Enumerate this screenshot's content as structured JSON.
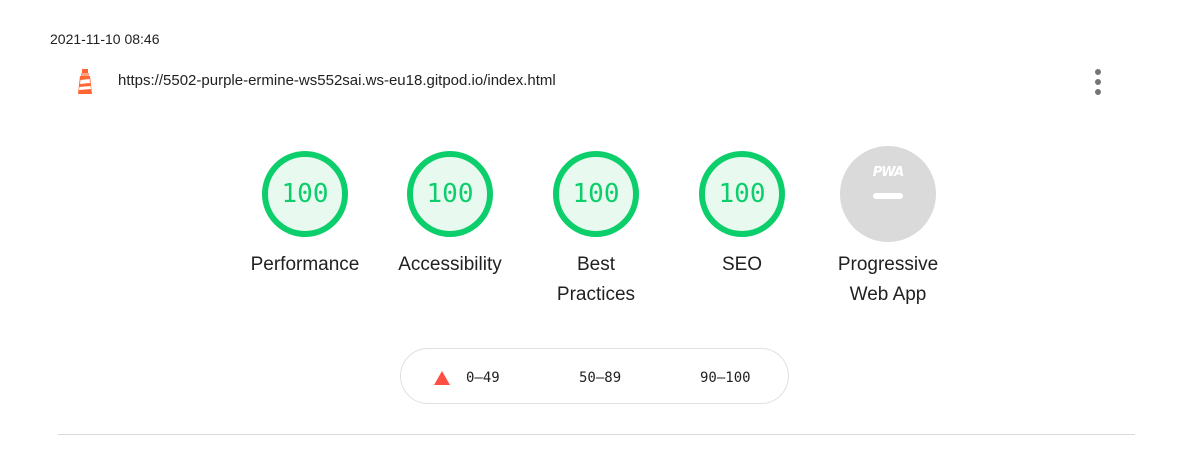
{
  "header": {
    "timestamp": "2021-11-10 08:46",
    "url": "https://5502-purple-ermine-ws552sai.ws-eu18.gitpod.io/index.html",
    "icons": {
      "app": "lighthouse-icon",
      "menu": "more-vertical-icon"
    }
  },
  "gauges": [
    {
      "score": "100",
      "label_line1": "Performance",
      "label_line2": ""
    },
    {
      "score": "100",
      "label_line1": "Accessibility",
      "label_line2": ""
    },
    {
      "score": "100",
      "label_line1": "Best",
      "label_line2": "Practices"
    },
    {
      "score": "100",
      "label_line1": "SEO",
      "label_line2": ""
    }
  ],
  "pwa": {
    "badge_text": "PWA",
    "label_line1": "Progressive",
    "label_line2": "Web App"
  },
  "legend": {
    "fail": "0–49",
    "average": "50–89",
    "pass": "90–100"
  },
  "colors": {
    "pass": "#0cce6b",
    "pass_fill": "#e8f9ef",
    "fail": "#ff4e42",
    "pwa_gray": "#dadada",
    "text": "#212121"
  }
}
